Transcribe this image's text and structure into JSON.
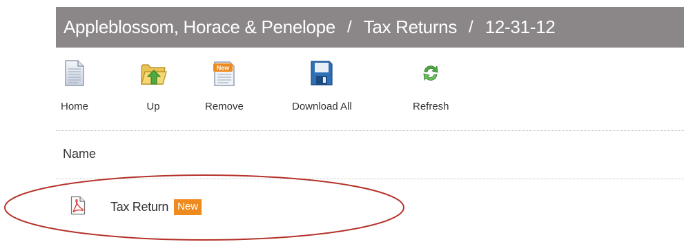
{
  "breadcrumb": {
    "client": "Appleblossom, Horace & Penelope",
    "separator": "/",
    "folder": "Tax Returns",
    "date": "12-31-12"
  },
  "toolbar": {
    "home_label": "Home",
    "up_label": "Up",
    "remove_label": "Remove",
    "download_all_label": "Download All",
    "refresh_label": "Refresh",
    "remove_icon_badge": "New"
  },
  "list": {
    "column_name": "Name",
    "items": [
      {
        "name": "Tax Return",
        "badge": "New",
        "icon": "pdf-icon"
      }
    ]
  },
  "colors": {
    "titlebar": "#8b8789",
    "badge": "#ef8a1e",
    "annotation_ellipse": "#b5322a"
  },
  "annotation": {
    "shape": "ellipse",
    "highlights": "list-item Tax Return"
  }
}
